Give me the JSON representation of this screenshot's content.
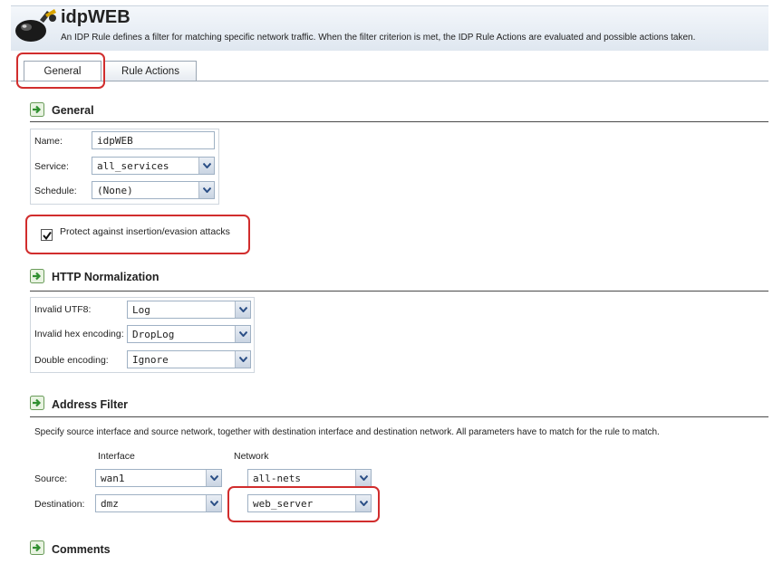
{
  "header": {
    "title": "idpWEB",
    "description": "An IDP Rule defines a filter for matching specific network traffic. When the filter criterion is met, the IDP Rule Actions are evaluated and possible actions taken."
  },
  "tabs": [
    {
      "label": "General"
    },
    {
      "label": "Rule Actions"
    }
  ],
  "general": {
    "title": "General",
    "name_label": "Name:",
    "name_value": "idpWEB",
    "service_label": "Service:",
    "service_value": "all_services",
    "schedule_label": "Schedule:",
    "schedule_value": "(None)",
    "protect_label": "Protect against insertion/evasion attacks",
    "protect_checked": true
  },
  "http": {
    "title": "HTTP Normalization",
    "invalid_utf8_label": "Invalid UTF8:",
    "invalid_utf8_value": "Log",
    "invalid_hex_label": "Invalid hex encoding:",
    "invalid_hex_value": "DropLog",
    "double_label": "Double encoding:",
    "double_value": "Ignore"
  },
  "address": {
    "title": "Address Filter",
    "description": "Specify source interface and source network, together with destination interface and destination network. All parameters have to match for the rule to match.",
    "interface_header": "Interface",
    "network_header": "Network",
    "source_label": "Source:",
    "source_interface": "wan1",
    "source_network": "all-nets",
    "destination_label": "Destination:",
    "destination_interface": "dmz",
    "destination_network": "web_server"
  },
  "comments": {
    "title": "Comments"
  },
  "colors": {
    "highlight": "#d12d2d",
    "section_arrow": "#2f8f2f"
  }
}
